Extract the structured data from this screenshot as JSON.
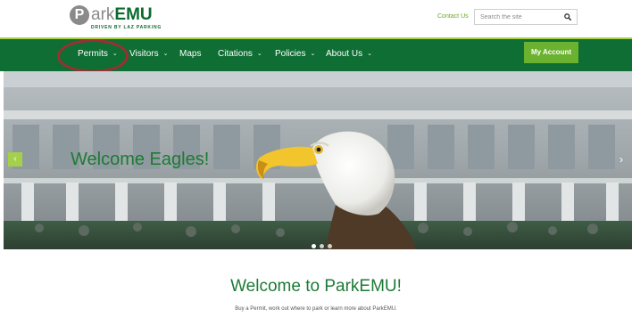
{
  "header": {
    "logo": {
      "letter": "P",
      "name_part1": "ark",
      "name_part2": "EMU",
      "tagline": "DRIVEN BY LAZ PARKING"
    },
    "contact_label": "Contact Us",
    "search": {
      "placeholder": "Search the site",
      "icon": "magnifier"
    }
  },
  "nav": {
    "items": [
      {
        "label": "Permits",
        "chevron": "⌄"
      },
      {
        "label": "Visitors",
        "chevron": "⌄"
      },
      {
        "label": "Maps",
        "chevron": ""
      },
      {
        "label": "Citations",
        "chevron": "⌄"
      },
      {
        "label": "Policies",
        "chevron": "⌄"
      },
      {
        "label": "About Us",
        "chevron": "⌄"
      }
    ],
    "account_label": "My Account"
  },
  "hero": {
    "title": "Welcome Eagles!",
    "prev_icon": "‹",
    "next_icon": "›",
    "slides": 3,
    "active_slide": 1
  },
  "intro": {
    "heading": "Welcome to ParkEMU!",
    "text": "Buy a Permit, work out where to park or learn more about ParkEMU."
  },
  "colors": {
    "brand_green": "#0e6e33",
    "accent_green": "#6ab22f",
    "annotation_red": "#9c2f33"
  }
}
